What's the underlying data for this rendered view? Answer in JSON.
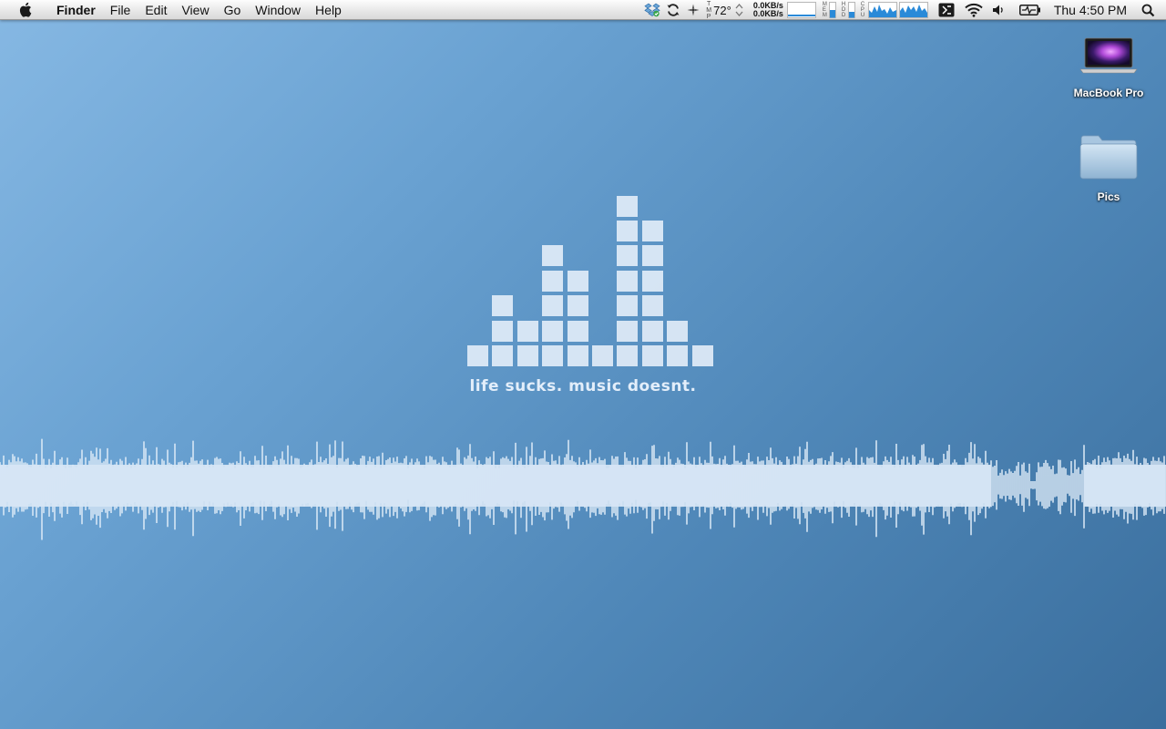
{
  "menubar": {
    "app_name": "Finder",
    "menus": [
      "File",
      "Edit",
      "View",
      "Go",
      "Window",
      "Help"
    ],
    "status": {
      "temp_label": "TMP",
      "temperature": "72°",
      "net_up": "0.0KB/s",
      "net_down": "0.0KB/s",
      "mem_label": "MEM",
      "hdd_label": "HDD",
      "cpu_label": "CPU",
      "clock": "Thu 4:50 PM"
    }
  },
  "desktop": {
    "icons": [
      {
        "label": "MacBook Pro",
        "icon": "laptop-icon"
      },
      {
        "label": "Pics",
        "icon": "folder-icon"
      }
    ],
    "wallpaper": {
      "tagline": "life sucks. music doesnt.",
      "equalizer_column_heights": [
        1,
        3,
        2,
        5,
        4,
        1,
        7,
        6,
        2,
        1
      ]
    }
  },
  "colors": {
    "wallpaper_light": "#86b8e3",
    "wallpaper_dark": "#3a6e9d",
    "accent_graph": "#2a8ad8"
  }
}
